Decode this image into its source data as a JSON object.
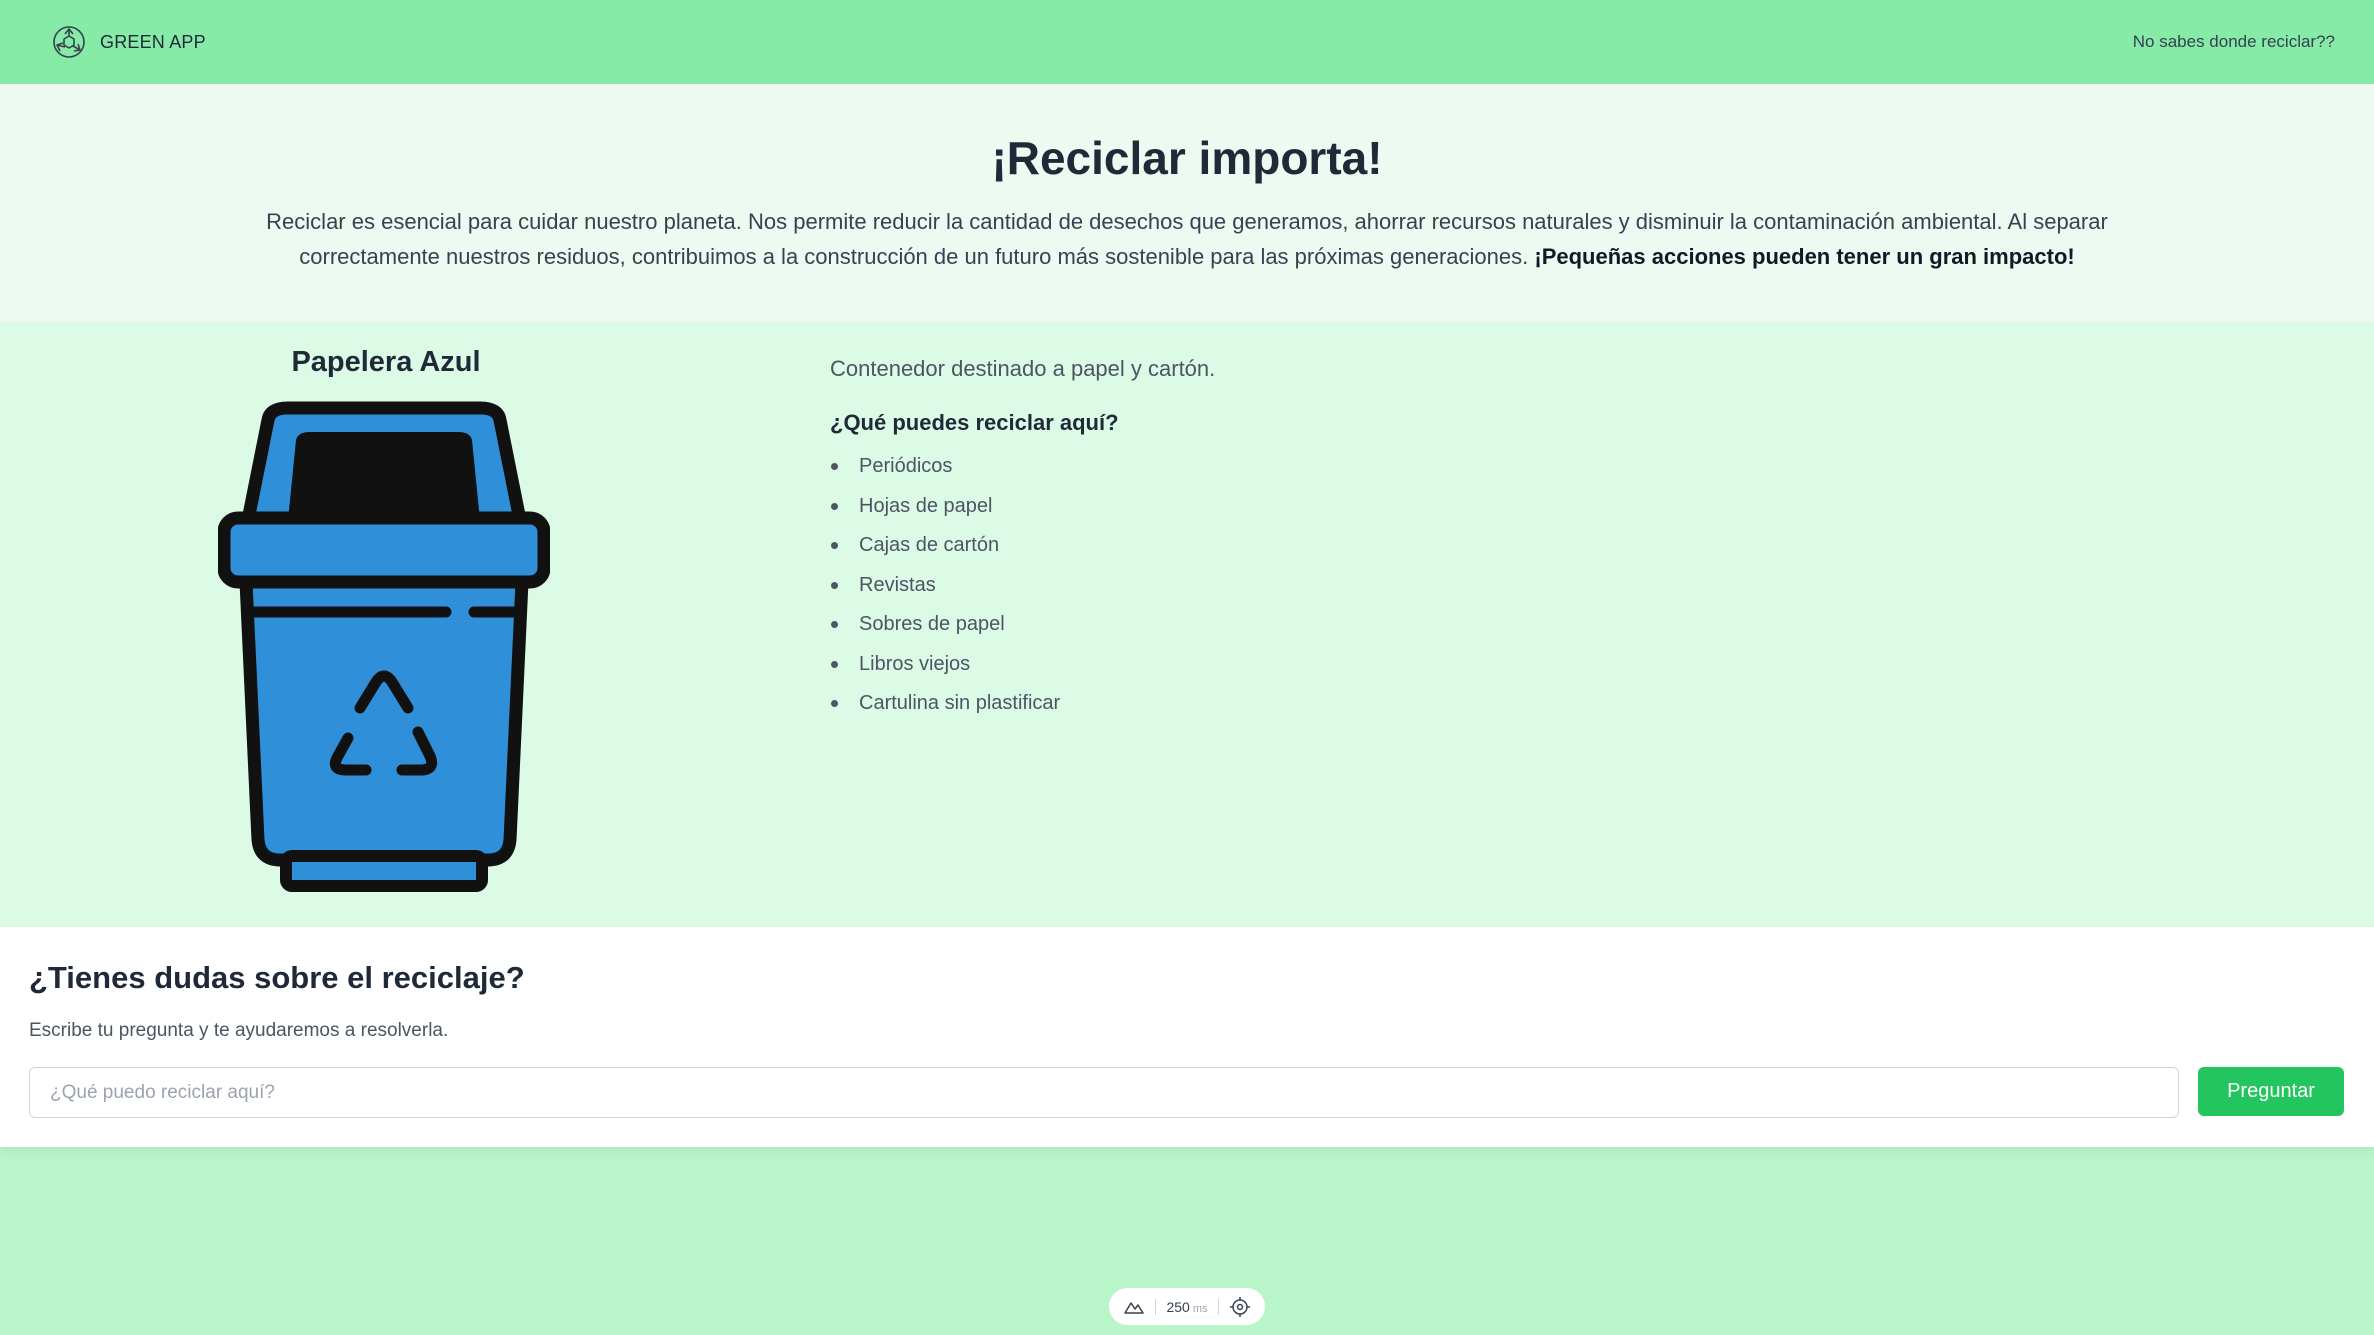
{
  "navbar": {
    "brand_name": "GREEN APP",
    "brand_icon": "recycle-icon",
    "link_label": "No sabes donde reciclar??"
  },
  "hero": {
    "title": "¡Reciclar importa!",
    "text": "Reciclar es esencial para cuidar nuestro planeta. Nos permite reducir la cantidad de desechos que generamos, ahorrar recursos naturales y disminuir la contaminación ambiental. Al separar correctamente nuestros residuos, contribuimos a la construcción de un futuro más sostenible para las próximas generaciones.",
    "text_bold": "¡Pequeñas acciones pueden tener un gran impacto!"
  },
  "bin": {
    "title": "Papelera Azul",
    "description": "Contenedor destinado a papel y cartón.",
    "question": "¿Qué puedes reciclar aquí?",
    "items": [
      "Periódicos",
      "Hojas de papel",
      "Cajas de cartón",
      "Revistas",
      "Sobres de papel",
      "Libros viejos",
      "Cartulina sin plastificar"
    ],
    "bin_color": "#2f8fd8"
  },
  "faq": {
    "title": "¿Tienes dudas sobre el reciclaje?",
    "subtitle": "Escribe tu pregunta y te ayudaremos a resolverla.",
    "input_value": "",
    "input_placeholder": "¿Qué puedo reciclar aquí?",
    "button_label": "Preguntar"
  },
  "toolbar": {
    "value": "250",
    "unit": "ms"
  },
  "colors": {
    "navbar_bg": "#86eba6",
    "hero_bg": "#eefaf1",
    "section_bg": "#dcfbe6",
    "page_bg": "#b8f5c9",
    "accent": "#22c55e"
  }
}
